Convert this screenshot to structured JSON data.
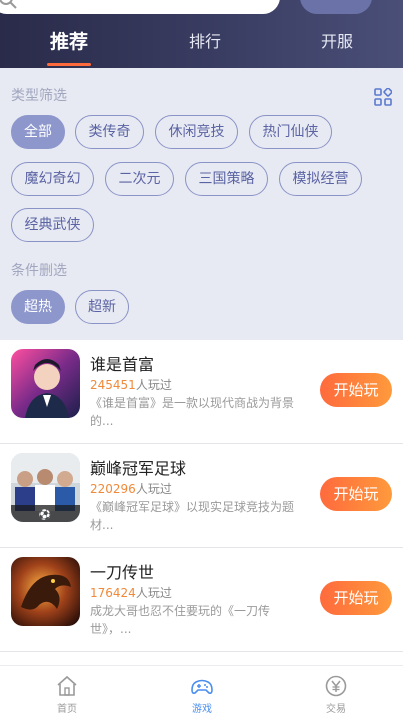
{
  "header": {
    "tabs": [
      {
        "label": "推荐",
        "active": true
      },
      {
        "label": "排行",
        "active": false
      },
      {
        "label": "开服",
        "active": false
      }
    ]
  },
  "filters": {
    "type_label": "类型筛选",
    "condition_label": "条件删选",
    "type_chips": [
      "全部",
      "类传奇",
      "休闲竞技",
      "热门仙侠",
      "魔幻奇幻",
      "二次元",
      "三国策略",
      "模拟经营",
      "经典武侠"
    ],
    "type_selected": "全部",
    "condition_chips": [
      "超热",
      "超新"
    ],
    "condition_selected": "超热"
  },
  "games": [
    {
      "title": "谁是首富",
      "players": "245451",
      "players_suffix": "人玩过",
      "desc": "《谁是首富》是一款以现代商战为背景的...",
      "button": "开始玩"
    },
    {
      "title": "巅峰冠军足球",
      "players": "220296",
      "players_suffix": "人玩过",
      "desc": "《巅峰冠军足球》以现实足球竞技为题材...",
      "button": "开始玩"
    },
    {
      "title": "一刀传世",
      "players": "176424",
      "players_suffix": "人玩过",
      "desc": "成龙大哥也忍不住要玩的《一刀传世》，...",
      "button": "开始玩"
    }
  ],
  "bottom_nav": [
    {
      "label": "首页",
      "icon": "home-icon",
      "active": false
    },
    {
      "label": "游戏",
      "icon": "gamepad-icon",
      "active": true
    },
    {
      "label": "交易",
      "icon": "yen-coin-icon",
      "active": false
    }
  ],
  "colors": {
    "accent": "#ff6a3d",
    "chip_active": "#8d97cc",
    "nav_active": "#4a8ef0"
  }
}
